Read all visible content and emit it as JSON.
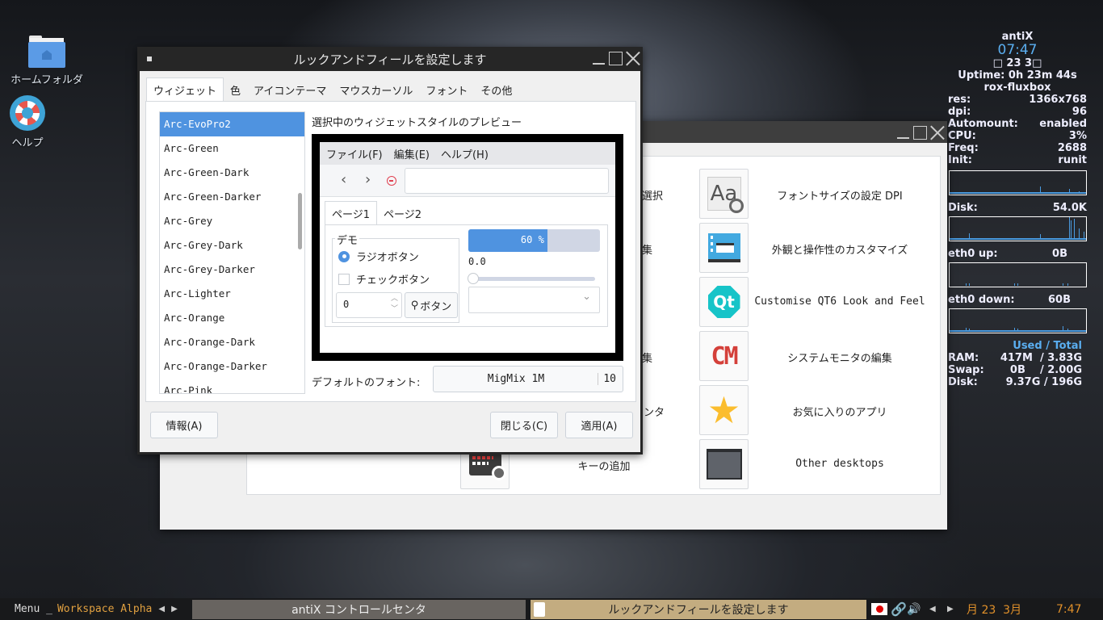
{
  "desktop": {
    "icons": [
      {
        "label": "ホームフォルダ",
        "icon": "folder-home-icon"
      },
      {
        "label": "ヘルプ",
        "icon": "lifebuoy-help-icon"
      }
    ]
  },
  "conky": {
    "host": "antiX",
    "time": "07:47",
    "date": "□ 23  3□",
    "uptime": "Uptime: 0h 23m 44s",
    "wm": "rox-fluxbox",
    "stats": [
      {
        "k": "res:",
        "v": "1366x768"
      },
      {
        "k": "dpi:",
        "v": "96"
      },
      {
        "k": "Automount:",
        "v": "enabled"
      },
      {
        "k": "CPU:",
        "v": "3%"
      },
      {
        "k": "Freq:",
        "v": "2688"
      },
      {
        "k": "Init:",
        "v": "runit"
      }
    ],
    "disk_label": "Disk:",
    "disk_val": "54.0K",
    "up_label": "eth0 up:",
    "up_val": "0B",
    "down_label": "eth0 down:",
    "down_val": "60B",
    "mem_header": "Used / Total",
    "mem": [
      {
        "k": "RAM:",
        "v": "417M  / 3.83G"
      },
      {
        "k": "Swap:",
        "v": "0B    / 2.00G"
      },
      {
        "k": "Disk:",
        "v": "9.37G / 196G"
      }
    ],
    "accent": "#4a9be0"
  },
  "control_center": {
    "title": "antiX コントロールセンタ",
    "left_items": [
      {
        "label": "選択"
      },
      {
        "label": "集"
      },
      {
        "label": ""
      },
      {
        "label": "集"
      },
      {
        "label": "センタ"
      },
      {
        "label": "キーの追加",
        "icon": "keyboard-gear-icon"
      }
    ],
    "right_items": [
      {
        "label": "フォントサイズの設定 DPI",
        "icon": "font-size-icon"
      },
      {
        "label": "外観と操作性のカスタマイズ",
        "icon": "window-appearance-icon"
      },
      {
        "label": "Customise QT6 Look and Feel",
        "icon": "qt-icon"
      },
      {
        "label": "システムモニタの編集",
        "icon": "conky-cm-icon"
      },
      {
        "label": "お気に入りのアプリ",
        "icon": "star-icon"
      },
      {
        "label": "Other desktops",
        "icon": "desktop-icon"
      }
    ]
  },
  "dialog": {
    "title": "ルックアンドフィールを設定します",
    "tabs": [
      "ウィジェット",
      "色",
      "アイコンテーマ",
      "マウスカーソル",
      "フォント",
      "その他"
    ],
    "styles": [
      "Arc-EvoPro2",
      "Arc-Green",
      "Arc-Green-Dark",
      "Arc-Green-Darker",
      "Arc-Grey",
      "Arc-Grey-Dark",
      "Arc-Grey-Darker",
      "Arc-Lighter",
      "Arc-Orange",
      "Arc-Orange-Dark",
      "Arc-Orange-Darker",
      "Arc-Pink"
    ],
    "preview_label": "選択中のウィジェットスタイルのプレビュー",
    "preview": {
      "menus": [
        "ファイル(F)",
        "編集(E)",
        "ヘルプ(H)"
      ],
      "tabs": [
        "ページ1",
        "ページ2"
      ],
      "group": "デモ",
      "radio": "ラジオボタン",
      "check": "チェックボタン",
      "spin": "0",
      "button": "ボタン",
      "progress_text": "60 %",
      "progress": 60,
      "slider_value": "0.0",
      "slider": 0
    },
    "font_label": "デフォルトのフォント:",
    "font_name": "MigMix 1M",
    "font_size": "10",
    "about": "情報(A)",
    "close": "閉じる(C)",
    "apply": "適用(A)"
  },
  "taskbar": {
    "menu": "Menu _",
    "workspace": "Workspace Alpha",
    "tasks": [
      "antiX コントロールセンタ",
      "ルックアンドフィールを設定します"
    ],
    "clock_date": "月 23  3月",
    "clock_time": "7:47"
  }
}
